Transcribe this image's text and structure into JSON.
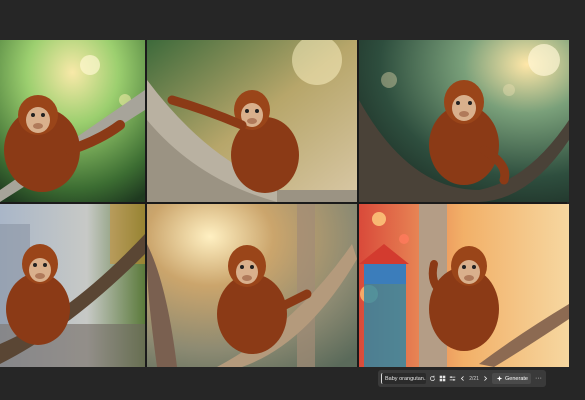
{
  "images": [
    {
      "id": 1,
      "alt": "orangutan-1"
    },
    {
      "id": 2,
      "alt": "orangutan-2"
    },
    {
      "id": 3,
      "alt": "orangutan-3"
    },
    {
      "id": 4,
      "alt": "orangutan-4"
    },
    {
      "id": 5,
      "alt": "orangutan-5"
    },
    {
      "id": 6,
      "alt": "orangutan-6"
    }
  ],
  "toolbar": {
    "prompt_value": "Baby orangutan...",
    "counter": "2/21",
    "generate_label": "Generate",
    "more_label": "···"
  },
  "colors": {
    "background": "#262626",
    "toolbar": "#3a3a3a",
    "fur": "#8b3a16",
    "face": "#d9b08c"
  }
}
